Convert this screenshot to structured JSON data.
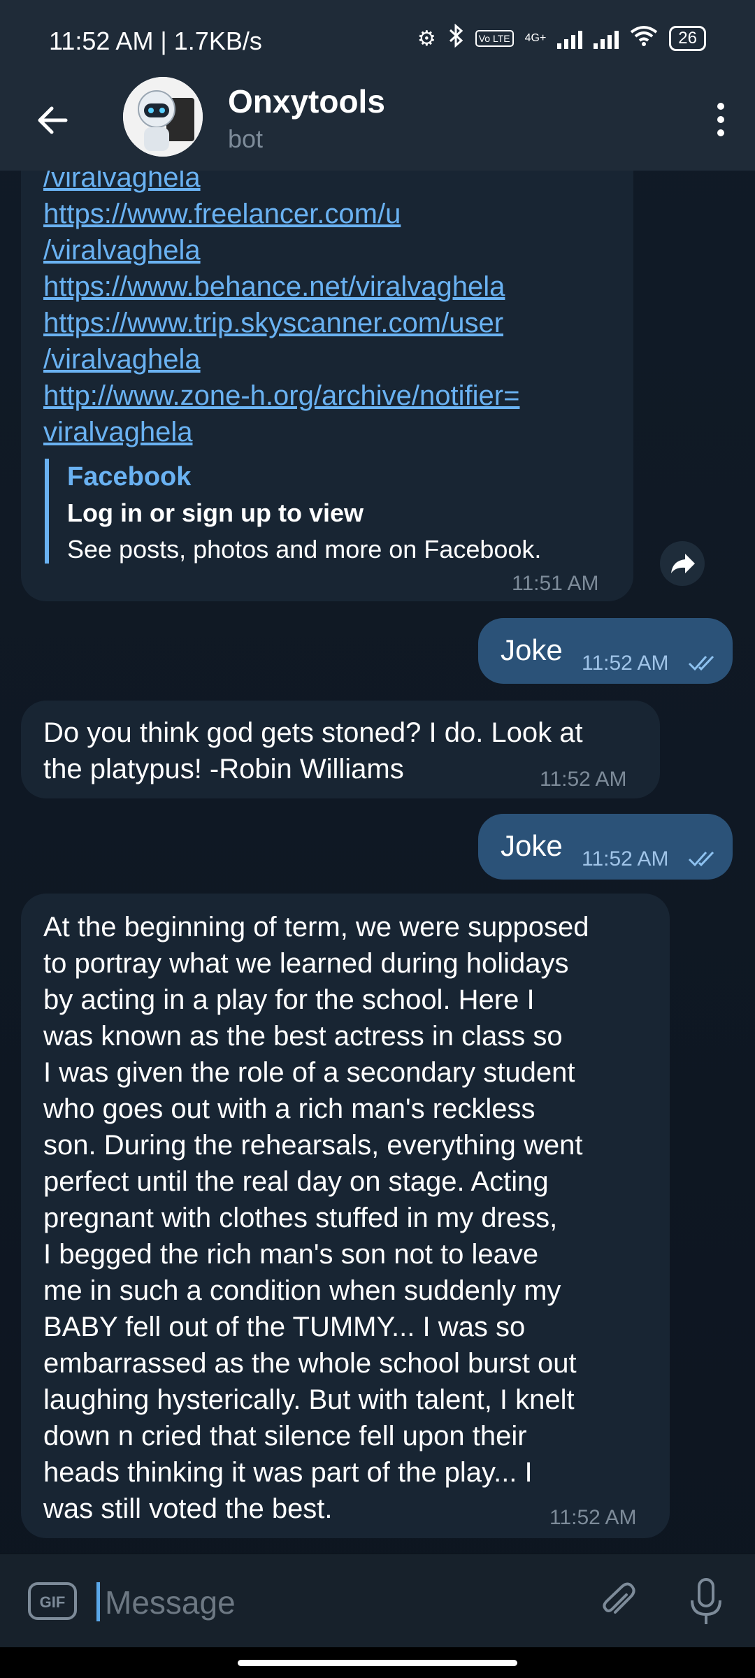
{
  "status_bar": {
    "time": "11:52 AM | 1.7KB/s",
    "lte_label": "Vo LTE",
    "network": "4G+",
    "battery": "26"
  },
  "header": {
    "name": "Onxytools",
    "subtitle": "bot"
  },
  "messages": [
    {
      "direction": "in",
      "links": [
        "/viralvaghela",
        "https://www.freelancer.com/u",
        "/viralvaghela",
        "https://www.behance.net/viralvaghela",
        "https://www.trip.skyscanner.com/user",
        "/viralvaghela",
        "http://www.zone-h.org/archive/notifier=",
        "viralvaghela"
      ],
      "preview": {
        "site": "Facebook",
        "title": "Log in or sign up to view",
        "description": "See posts, photos and more on Facebook."
      },
      "time": "11:51 AM"
    },
    {
      "direction": "out",
      "text": "Joke",
      "time": "11:52 AM"
    },
    {
      "direction": "in",
      "lines": [
        "Do you think god gets stoned? I do. Look at",
        "the platypus! -Robin Williams"
      ],
      "time": "11:52 AM"
    },
    {
      "direction": "out",
      "text": "Joke",
      "time": "11:52 AM"
    },
    {
      "direction": "in",
      "lines": [
        "At the beginning of term, we were supposed",
        "to portray what we learned during holidays",
        "by acting in a play for the school. Here I",
        "was known as the best actress in class so",
        "I was given the role of a secondary student",
        "who goes out with a rich man's reckless",
        "son. During the rehearsals, everything went",
        "perfect until the real day on stage. Acting",
        "pregnant with clothes stuffed in my dress,",
        "I begged the rich man's son not to leave",
        "me in such a condition when suddenly my",
        "BABY fell out of the TUMMY...  I was so",
        "embarrassed as the whole school burst out",
        "laughing hysterically. But with talent, I knelt",
        "down n cried that silence fell upon their",
        "heads thinking it was part of the play... I",
        "was still voted the best."
      ],
      "time": "11:52 AM"
    }
  ],
  "input": {
    "placeholder": "Message",
    "gif_label": "GIF"
  },
  "icons": {
    "back": "back-arrow-icon",
    "more": "more-vert-icon",
    "share": "share-icon",
    "attach": "paperclip-icon",
    "mic": "microphone-icon",
    "read": "double-check-icon"
  },
  "colors": {
    "background": "#0e1621",
    "header": "#1f2b38",
    "incoming_bubble": "#182533",
    "outgoing_bubble": "#2b5278",
    "link": "#6ab2f2"
  }
}
